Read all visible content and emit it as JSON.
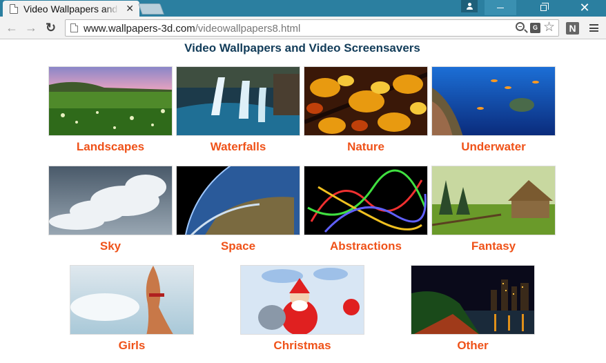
{
  "browser": {
    "tab_title": "Video Wallpapers and Video Screensavers",
    "tab_close": "✕",
    "url_host": "www.wallpapers-3d.com",
    "url_path": "/videowallpapers8.html",
    "translate_label": "G",
    "extension_label": "N",
    "nav_back": "←",
    "nav_forward": "→",
    "nav_reload": "↻",
    "star": "☆",
    "close_window": "✕"
  },
  "page": {
    "title": "Video Wallpapers and Video Screensavers",
    "categories": [
      {
        "label": "Landscapes"
      },
      {
        "label": "Waterfalls"
      },
      {
        "label": "Nature"
      },
      {
        "label": "Underwater"
      },
      {
        "label": "Sky"
      },
      {
        "label": "Space"
      },
      {
        "label": "Abstractions"
      },
      {
        "label": "Fantasy"
      },
      {
        "label": "Girls"
      },
      {
        "label": "Christmas"
      },
      {
        "label": "Other"
      }
    ]
  },
  "colors": {
    "titlebar": "#2b7fa0",
    "category_link": "#ef5219",
    "page_title": "#123c59"
  }
}
